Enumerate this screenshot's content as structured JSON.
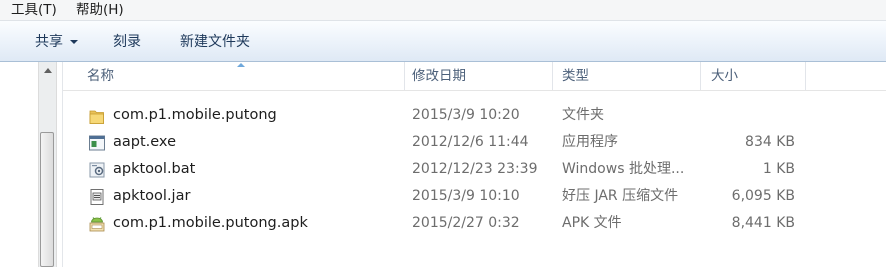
{
  "menubar": {
    "items": [
      {
        "label": "工具(T)"
      },
      {
        "label": "帮助(H)"
      }
    ]
  },
  "toolbar": {
    "share_label": "共享",
    "burn_label": "刻录",
    "new_folder_label": "新建文件夹"
  },
  "columns": {
    "name": "名称",
    "date": "修改日期",
    "type": "类型",
    "size": "大小"
  },
  "files": [
    {
      "name": "com.p1.mobile.putong",
      "date": "2015/3/9 10:20",
      "type": "文件夹",
      "size": "",
      "icon": "folder-icon"
    },
    {
      "name": "aapt.exe",
      "date": "2012/12/6 11:44",
      "type": "应用程序",
      "size": "834 KB",
      "icon": "exe-icon"
    },
    {
      "name": "apktool.bat",
      "date": "2012/12/23 23:39",
      "type": "Windows 批处理...",
      "size": "1 KB",
      "icon": "bat-icon"
    },
    {
      "name": "apktool.jar",
      "date": "2015/3/9 10:10",
      "type": "好压 JAR 压缩文件",
      "size": "6,095 KB",
      "icon": "jar-icon"
    },
    {
      "name": "com.p1.mobile.putong.apk",
      "date": "2015/2/27 0:32",
      "type": "APK 文件",
      "size": "8,441 KB",
      "icon": "apk-icon"
    }
  ]
}
